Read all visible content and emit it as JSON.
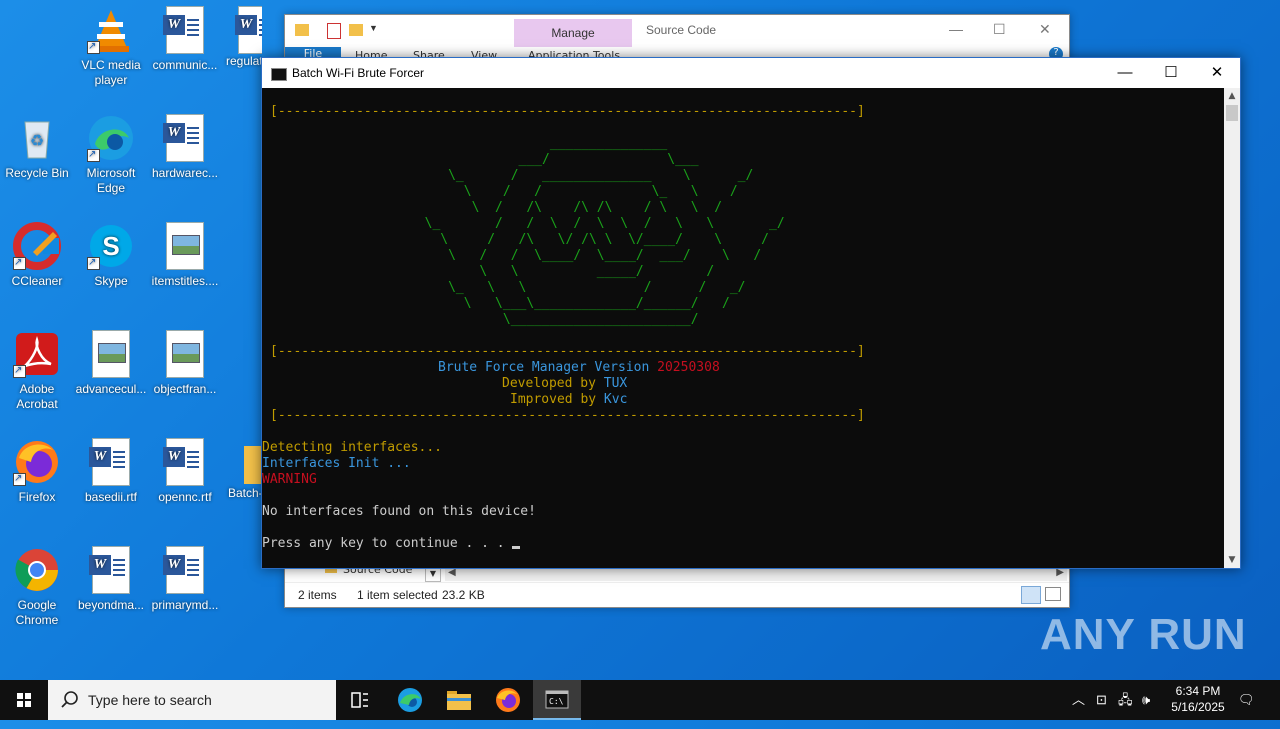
{
  "desktop": {
    "icons": [
      {
        "label": "VLC media player"
      },
      {
        "label": "communic..."
      },
      {
        "label": "regulat"
      },
      {
        "label": "Recycle Bin"
      },
      {
        "label": "Microsoft Edge"
      },
      {
        "label": "hardwarec..."
      },
      {
        "label": "CCleaner"
      },
      {
        "label": "Skype"
      },
      {
        "label": "itemstitles...."
      },
      {
        "label": "Adobe Acrobat"
      },
      {
        "label": "advancecul..."
      },
      {
        "label": "objectfran..."
      },
      {
        "label": "Firefox"
      },
      {
        "label": "basedii.rtf"
      },
      {
        "label": "opennc.rtf"
      },
      {
        "label": "Batch-"
      },
      {
        "label": "Google Chrome"
      },
      {
        "label": "beyondma..."
      },
      {
        "label": "primarymd..."
      }
    ]
  },
  "explorer": {
    "ribbon_context_tab": "Manage",
    "title": "Source Code",
    "tabs": [
      "File",
      "Home",
      "Share",
      "View",
      "Application Tools"
    ],
    "nav_item": "Source Code",
    "status": {
      "items": "2 items",
      "selected": "1 item selected",
      "size": "23.2 KB"
    }
  },
  "console": {
    "title": "Batch Wi-Fi Brute Forcer",
    "divider": "[--------------------------------------------------------------------------]",
    "banner_art": [
      "                        _______________",
      "                    ___/               \\___",
      "           \\_      /   ______________    \\      _/",
      "             \\    /   /              \\_   \\    /",
      "              \\  /   /\\    /\\ /\\    / \\   \\  /",
      "        \\_       /   /  \\  /  \\  \\  /   \\   \\       _/",
      "          \\     /   /\\   \\/ /\\ \\  \\/____/    \\     /",
      "           \\   /   /  \\____/  \\____/  ___/    \\   /",
      "               \\   \\          _____/        /",
      "           \\_   \\   \\               /      /   _/",
      "             \\   \\___\\_____________/______/   /",
      "                  \\_______________________/"
    ],
    "manager_label": "Brute Force Manager Version ",
    "version": "20250308",
    "developed_label": "Developed by ",
    "developer": "TUX",
    "improved_label": "Improved by ",
    "improver": "Kvc",
    "line_detecting": "Detecting interfaces...",
    "line_init": "Interfaces Init ...",
    "line_warning": "WARNING",
    "line_none": "No interfaces found on this device!",
    "line_press": "Press any key to continue . . . "
  },
  "taskbar": {
    "search_placeholder": "Type here to search",
    "time": "6:34 PM",
    "date": "5/16/2025"
  },
  "watermark": "ANY RUN"
}
